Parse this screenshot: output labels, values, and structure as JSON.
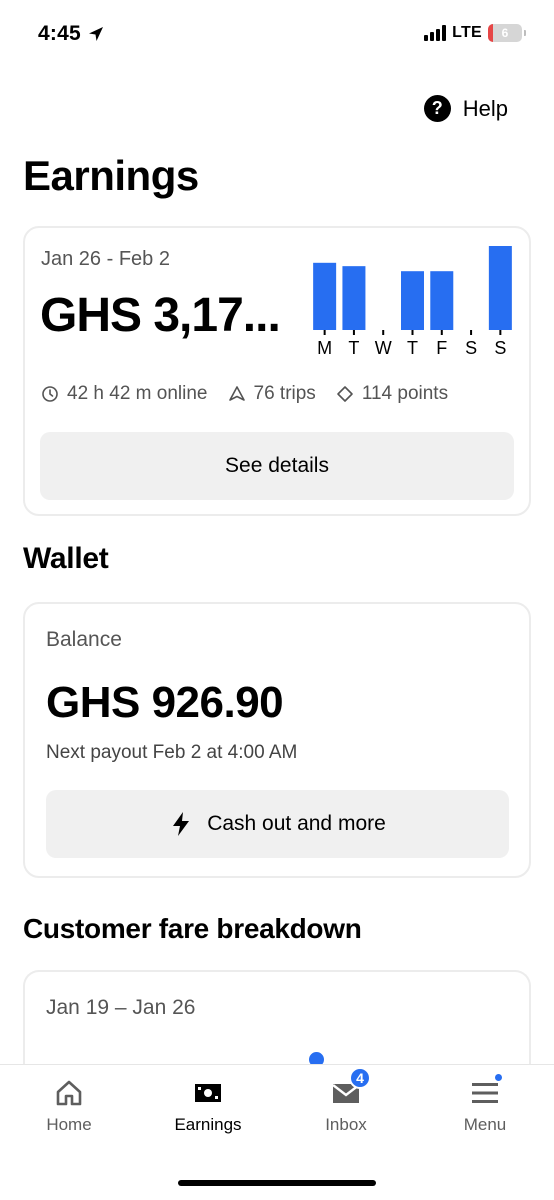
{
  "status_bar": {
    "time": "4:45",
    "network": "LTE",
    "battery_level": "6"
  },
  "header": {
    "help_label": "Help",
    "title": "Earnings"
  },
  "earnings_card": {
    "date_range": "Jan 26 - Feb 2",
    "amount": "GHS 3,17...",
    "chart_data": {
      "type": "bar",
      "categories": [
        "M",
        "T",
        "W",
        "T",
        "F",
        "S",
        "S"
      ],
      "values": [
        0.8,
        0.76,
        0,
        0.7,
        0.7,
        0,
        1.0
      ],
      "color": "#276ef1"
    },
    "stats": {
      "online": "42 h 42 m online",
      "trips": "76 trips",
      "points": "114 points"
    },
    "see_details_label": "See details"
  },
  "wallet": {
    "title": "Wallet",
    "balance_label": "Balance",
    "balance_amount": "GHS 926.90",
    "payout_text": "Next payout Feb 2 at 4:00 AM",
    "cash_out_label": "Cash out and more"
  },
  "fare_breakdown": {
    "title": "Customer fare breakdown",
    "date_range": "Jan 19 – Jan 26"
  },
  "tabbar": {
    "home": "Home",
    "earnings": "Earnings",
    "inbox": "Inbox",
    "inbox_badge": "4",
    "menu": "Menu"
  },
  "colors": {
    "accent": "#276ef1",
    "button_bg": "#f0f0f0"
  }
}
